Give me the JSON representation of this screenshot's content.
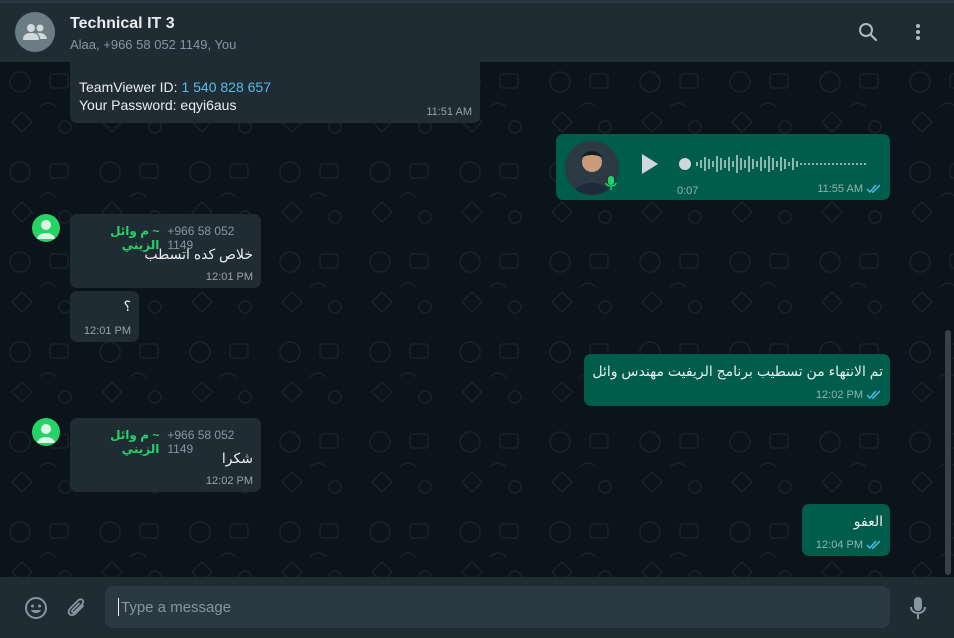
{
  "header": {
    "title": "Technical IT 3",
    "subtitle": "Alaa, +966 58 052 1149, You"
  },
  "messages": {
    "m1": {
      "line1_label": "TeamViewer ID: ",
      "line1_link": "1 540 828 657",
      "line2": "Your Password: eqyi6aus",
      "time": "11:51 AM"
    },
    "voice": {
      "duration": "0:07",
      "time": "11:55 AM"
    },
    "m3": {
      "sender_phone": "+966 58 052 1149",
      "sender_name": "~ م وائل الزيني",
      "text": "خلاص كده اتسطب",
      "time": "12:01 PM"
    },
    "m4": {
      "text": "؟",
      "time": "12:01 PM"
    },
    "m5": {
      "text": "تم الانتهاء من تسطيب برنامج الريفيت مهندس وائل",
      "time": "12:02 PM"
    },
    "m6": {
      "sender_phone": "+966 58 052 1149",
      "sender_name": "~ م وائل الزيني",
      "text": "شكرا",
      "time": "12:02 PM"
    },
    "m7": {
      "text": "العفو",
      "time": "12:04 PM"
    }
  },
  "composer": {
    "placeholder": "Type a message"
  },
  "colors": {
    "header_bg": "#202c33",
    "chat_bg": "#0b141a",
    "incoming_bubble": "#202c33",
    "outgoing_bubble": "#005c4b",
    "sender_name": "#25d366",
    "link": "#53bdeb",
    "read_ticks": "#53bdeb"
  },
  "icons": [
    "group-avatar-icon",
    "search-icon",
    "menu-icon",
    "play-icon",
    "mic-badge-icon",
    "read-ticks-icon",
    "user-avatar-icon",
    "emoji-icon",
    "attach-icon",
    "mic-icon"
  ]
}
